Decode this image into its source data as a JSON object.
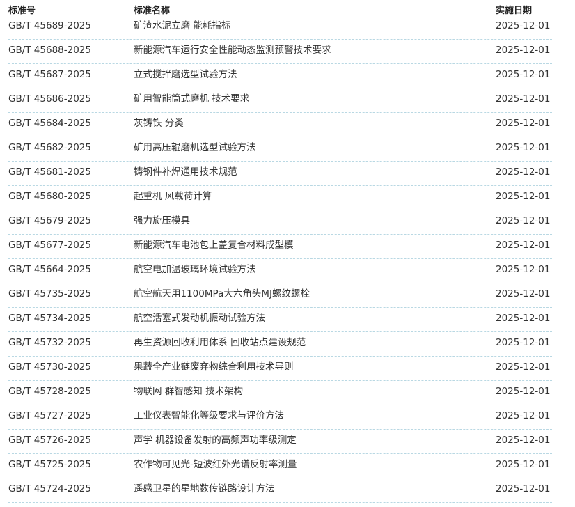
{
  "header": {
    "code": "标准号",
    "name": "标准名称",
    "date": "实施日期"
  },
  "rows": [
    {
      "code": "GB/T 45689-2025",
      "name": "矿渣水泥立磨 能耗指标",
      "date": "2025-12-01"
    },
    {
      "code": "GB/T 45688-2025",
      "name": "新能源汽车运行安全性能动态监测预警技术要求",
      "date": "2025-12-01"
    },
    {
      "code": "GB/T 45687-2025",
      "name": "立式搅拌磨选型试验方法",
      "date": "2025-12-01"
    },
    {
      "code": "GB/T 45686-2025",
      "name": "矿用智能筒式磨机 技术要求",
      "date": "2025-12-01"
    },
    {
      "code": "GB/T 45684-2025",
      "name": "灰铸铁 分类",
      "date": "2025-12-01"
    },
    {
      "code": "GB/T 45682-2025",
      "name": "矿用高压辊磨机选型试验方法",
      "date": "2025-12-01"
    },
    {
      "code": "GB/T 45681-2025",
      "name": "铸钢件补焊通用技术规范",
      "date": "2025-12-01"
    },
    {
      "code": "GB/T 45680-2025",
      "name": "起重机 风载荷计算",
      "date": "2025-12-01"
    },
    {
      "code": "GB/T 45679-2025",
      "name": "强力旋压模具",
      "date": "2025-12-01"
    },
    {
      "code": "GB/T 45677-2025",
      "name": "新能源汽车电池包上盖复合材料成型模",
      "date": "2025-12-01"
    },
    {
      "code": "GB/T 45664-2025",
      "name": "航空电加温玻璃环境试验方法",
      "date": "2025-12-01"
    },
    {
      "code": "GB/T 45735-2025",
      "name": "航空航天用1100MPa大六角头MJ螺纹螺栓",
      "date": "2025-12-01"
    },
    {
      "code": "GB/T 45734-2025",
      "name": "航空活塞式发动机振动试验方法",
      "date": "2025-12-01"
    },
    {
      "code": "GB/T 45732-2025",
      "name": "再生资源回收利用体系 回收站点建设规范",
      "date": "2025-12-01"
    },
    {
      "code": "GB/T 45730-2025",
      "name": "果蔬全产业链废弃物综合利用技术导则",
      "date": "2025-12-01"
    },
    {
      "code": "GB/T 45728-2025",
      "name": "物联网 群智感知 技术架构",
      "date": "2025-12-01"
    },
    {
      "code": "GB/T 45727-2025",
      "name": "工业仪表智能化等级要求与评价方法",
      "date": "2025-12-01"
    },
    {
      "code": "GB/T 45726-2025",
      "name": "声学 机器设备发射的高频声功率级测定",
      "date": "2025-12-01"
    },
    {
      "code": "GB/T 45725-2025",
      "name": "农作物可见光-短波红外光谱反射率测量",
      "date": "2025-12-01"
    },
    {
      "code": "GB/T 45724-2025",
      "name": "遥感卫星的星地数传链路设计方法",
      "date": "2025-12-01"
    }
  ]
}
